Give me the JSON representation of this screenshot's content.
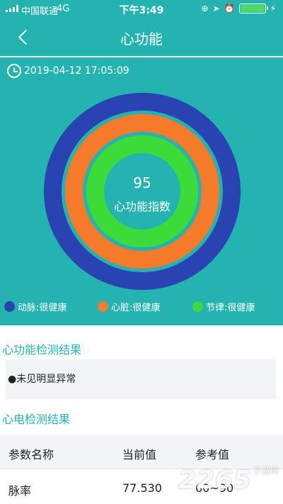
{
  "status_bar": {
    "carrier": "中国联通",
    "network": "4G",
    "time": "下午3:49",
    "icons": [
      "orientation-lock-icon",
      "location-icon",
      "alarm-icon"
    ],
    "battery_level": 1.0
  },
  "nav": {
    "title": "心功能",
    "back_icon": "chevron-left-icon"
  },
  "record": {
    "datetime": "2019-04-12 17:05:09"
  },
  "rings": {
    "score": "95",
    "score_label": "心功能指数",
    "colors": {
      "artery": "#2a43b2",
      "heart": "#f57a2a",
      "rhythm": "#3ddb3a"
    }
  },
  "legend": [
    {
      "label": "动脉:很健康",
      "color": "#2a43b2"
    },
    {
      "label": "心脏:很健康",
      "color": "#f57a2a"
    },
    {
      "label": "节律:很健康",
      "color": "#3ddb3a"
    }
  ],
  "function_result": {
    "title": "心功能检测结果",
    "text": "●未见明显异常"
  },
  "ecg_result": {
    "title": "心电检测结果",
    "headers": [
      "参数名称",
      "当前值",
      "参考值"
    ],
    "rows": [
      [
        "脉率",
        "77.530",
        "60~90"
      ]
    ]
  },
  "watermark": {
    "number": "2265",
    "sub": "手游网"
  },
  "theme": {
    "accent": "#24b3b0"
  }
}
